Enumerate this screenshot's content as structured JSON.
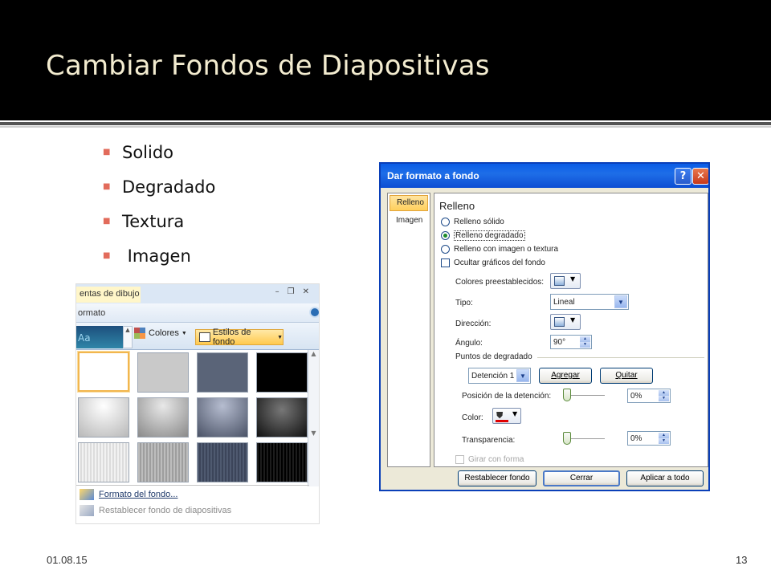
{
  "slide": {
    "title": "Cambiar Fondos de Diapositivas",
    "bullets": [
      "Solido",
      "Degradado",
      "Textura",
      " Imagen"
    ],
    "date": "01.08.15",
    "page_number": "13"
  },
  "ribbon": {
    "context_tab": "entas de dibujo",
    "tab2": "ormato",
    "thumb_text": "Aa",
    "colores_label": "Colores",
    "estilos_label": "Estilos de fondo",
    "menu": {
      "formato_fondo": "Formato del fondo...",
      "restablecer": "Restablecer fondo de diapositivas"
    },
    "colors": {
      "accent": "#ffc94d",
      "selected_border": "#f2b64e",
      "ribbon_bg": "#dbe7f5"
    }
  },
  "dialog": {
    "title": "Dar formato a fondo",
    "help_icon": "?",
    "close_icon": "✕",
    "side_tabs": [
      "Relleno",
      "Imagen"
    ],
    "section": "Relleno",
    "radios": [
      "Relleno sólido",
      "Relleno degradado",
      "Relleno con imagen o textura"
    ],
    "selected_radio": "Relleno degradado",
    "hide_graphics": "Ocultar gráficos del fondo",
    "preset_colors_label": "Colores preestablecidos:",
    "tipo_label": "Tipo:",
    "tipo_value": "Lineal",
    "direccion_label": "Dirección:",
    "angulo_label": "Ángulo:",
    "angulo_value": "90°",
    "puntos_label": "Puntos de degradado",
    "stop_value": "Detención 1",
    "agregar": "Agregar",
    "quitar": "Quitar",
    "posicion_label": "Posición de la detención:",
    "posicion_value": "0%",
    "posicion_level": 0,
    "color_label": "Color:",
    "transparencia_label": "Transparencia:",
    "transparencia_value": "0%",
    "transparencia_level": 0,
    "girar_label": "Girar con forma",
    "buttons": {
      "restablecer": "Restablecer fondo",
      "cerrar": "Cerrar",
      "aplicar": "Aplicar a todo"
    },
    "colors": {
      "titlebar": "#0a5ce6",
      "face": "#ece9d8",
      "active_tab": "#ffcf5c"
    }
  }
}
